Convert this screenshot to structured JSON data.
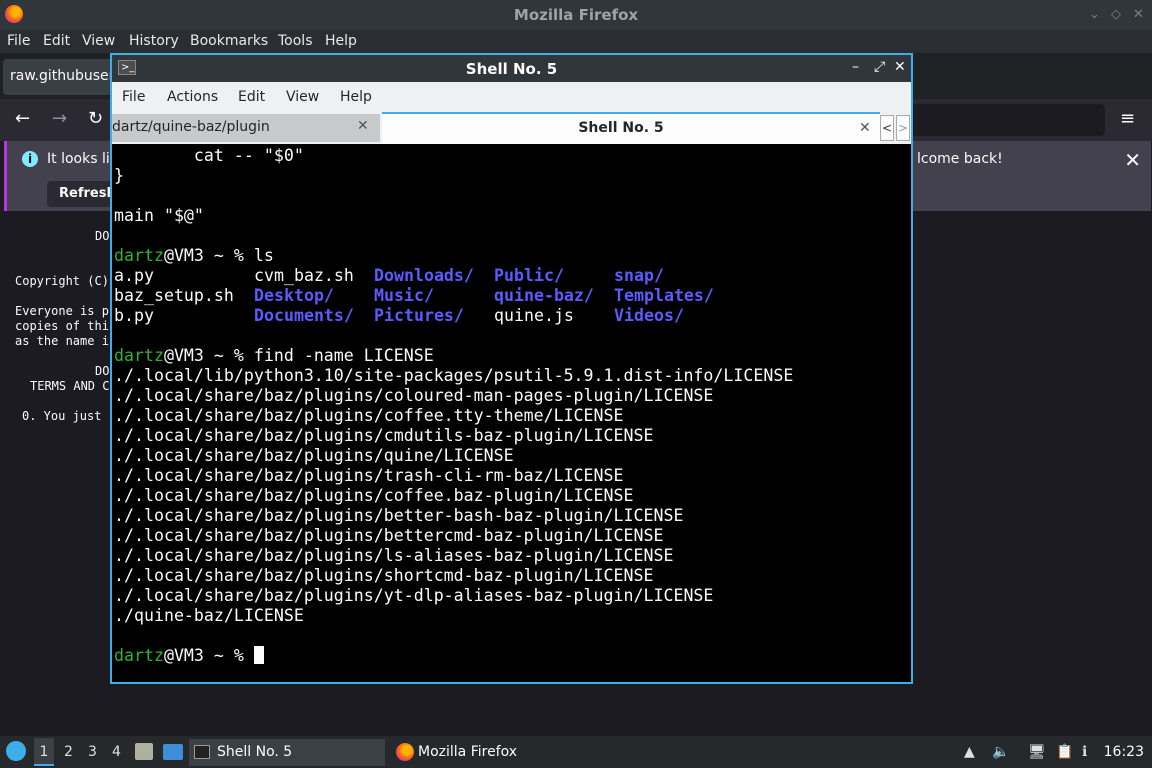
{
  "firefox": {
    "title": "Mozilla Firefox",
    "menu": [
      "File",
      "Edit",
      "View",
      "History",
      "Bookmarks",
      "Tools",
      "Help"
    ],
    "tab_label": "raw.githubuser",
    "notice_text": "It looks lik",
    "notice_tail": "lcome back!",
    "refresh_label": "Refresh",
    "page_lines": [
      "DO",
      "Copyright (C)",
      "Everyone is p",
      "copies of thi",
      "as the name i",
      "DO",
      "TERMS AND C",
      "0. You just"
    ]
  },
  "konsole": {
    "title": "Shell No. 5",
    "menu": [
      "File",
      "Actions",
      "Edit",
      "View",
      "Help"
    ],
    "tab1_label": "dartz/quine-baz/plugin",
    "tab2_label": "Shell No. 5",
    "user": "dartz",
    "host_prompt": "@VM3 ~ % ",
    "lines": {
      "l1": "        cat -- \"$0\"",
      "l2": "}",
      "l3": "main \"$@\"",
      "cmd_ls": "ls",
      "cmd_find": "find -name LICENSE"
    },
    "ls_plain": [
      "a.py",
      "cvm_baz.sh",
      "baz_setup.sh",
      "b.py",
      "quine.js"
    ],
    "ls_dirs": [
      "Downloads/",
      "Public/",
      "snap/",
      "Desktop/",
      "Music/",
      "quine-baz/",
      "Templates/",
      "Documents/",
      "Pictures/",
      "Videos/"
    ],
    "find_results": [
      "./.local/lib/python3.10/site-packages/psutil-5.9.1.dist-info/LICENSE",
      "./.local/share/baz/plugins/coloured-man-pages-plugin/LICENSE",
      "./.local/share/baz/plugins/coffee.tty-theme/LICENSE",
      "./.local/share/baz/plugins/cmdutils-baz-plugin/LICENSE",
      "./.local/share/baz/plugins/quine/LICENSE",
      "./.local/share/baz/plugins/trash-cli-rm-baz/LICENSE",
      "./.local/share/baz/plugins/coffee.baz-plugin/LICENSE",
      "./.local/share/baz/plugins/better-bash-baz-plugin/LICENSE",
      "./.local/share/baz/plugins/bettercmd-baz-plugin/LICENSE",
      "./.local/share/baz/plugins/ls-aliases-baz-plugin/LICENSE",
      "./.local/share/baz/plugins/shortcmd-baz-plugin/LICENSE",
      "./.local/share/baz/plugins/yt-dlp-aliases-baz-plugin/LICENSE",
      "./quine-baz/LICENSE"
    ]
  },
  "taskbar": {
    "workspaces": [
      "1",
      "2",
      "3",
      "4"
    ],
    "shell_label": "Shell No. 5",
    "firefox_label": "Mozilla Firefox",
    "clock": "16:23"
  },
  "colors": {
    "accent": "#3daee9",
    "prompt_user": "#2fb32f",
    "dir": "#5b5bff"
  }
}
